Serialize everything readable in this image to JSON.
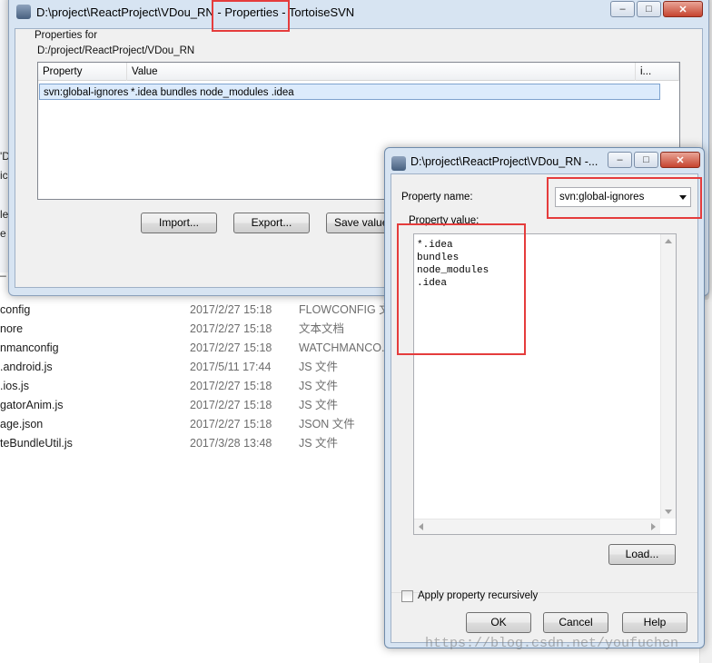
{
  "explorer": {
    "side_fragments": [
      "'D",
      "ic",
      "le",
      "e",
      "_",
      "config",
      "nore",
      "nmanconfig"
    ],
    "files": [
      {
        "name": "config",
        "date": "2017/2/27 15:18",
        "type": "FLOWCONFIG 文"
      },
      {
        "name": "nore",
        "date": "2017/2/27 15:18",
        "type": "文本文档"
      },
      {
        "name": "nmanconfig",
        "date": "2017/2/27 15:18",
        "type": "WATCHMANCO..."
      },
      {
        "name": ".android.js",
        "date": "2017/5/11 17:44",
        "type": "JS 文件"
      },
      {
        "name": ".ios.js",
        "date": "2017/2/27 15:18",
        "type": "JS 文件"
      },
      {
        "name": "gatorAnim.js",
        "date": "2017/2/27 15:18",
        "type": "JS 文件"
      },
      {
        "name": "age.json",
        "date": "2017/2/27 15:18",
        "type": "JSON 文件"
      },
      {
        "name": "teBundleUtil.js",
        "date": "2017/3/28 13:48",
        "type": "JS 文件"
      }
    ]
  },
  "properties_window": {
    "title": "D:\\project\\ReactProject\\VDou_RN - Properties - TortoiseSVN",
    "properties_for_label": "Properties for",
    "path": "D:/project/ReactProject/VDou_RN",
    "columns": [
      "Property",
      "Value",
      "i..."
    ],
    "rows": [
      {
        "property": "svn:global-ignores",
        "value": "*.idea bundles node_modules .idea"
      }
    ],
    "buttons": {
      "import": "Import...",
      "export": "Export...",
      "save_value": "Save value..."
    }
  },
  "edit_dialog": {
    "title": "D:\\project\\ReactProject\\VDou_RN -...",
    "property_name_label": "Property name:",
    "property_name_value": "svn:global-ignores",
    "property_value_label": "Property value:",
    "property_value_lines": [
      "*.idea",
      "bundles",
      "node_modules",
      ".idea"
    ],
    "load_button": "Load...",
    "apply_recursive_label": "Apply property recursively",
    "apply_recursive_checked": false,
    "ok": "OK",
    "cancel": "Cancel",
    "help": "Help"
  },
  "caption_buttons": {
    "minimize": "–",
    "maximize": "□",
    "close": "✕"
  },
  "watermark": "https://blog.csdn.net/youfuchen",
  "colors": {
    "highlight_box": "#e53c3c",
    "selection": "#dcebfc"
  }
}
